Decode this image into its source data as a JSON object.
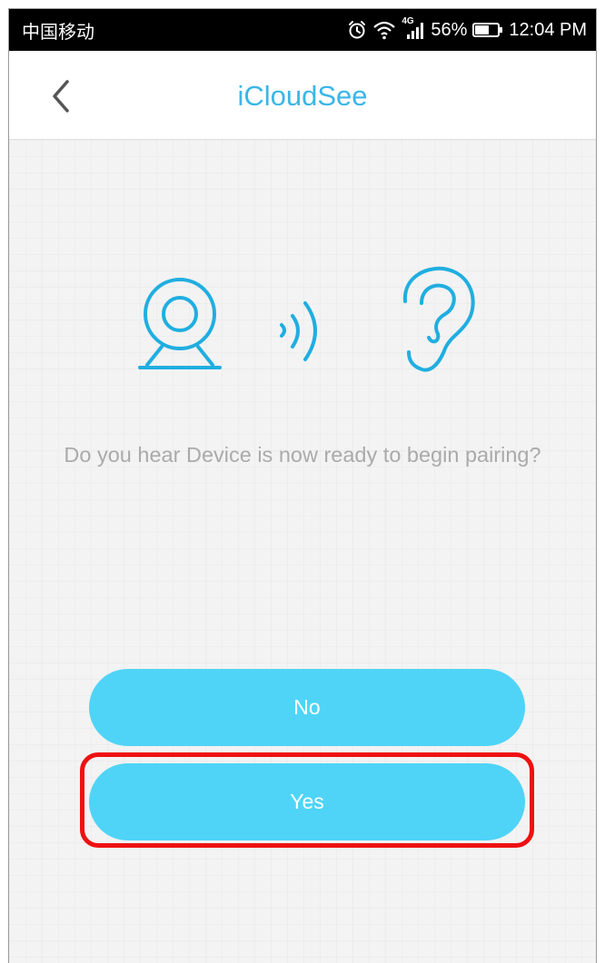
{
  "status_bar": {
    "carrier": "中国移动",
    "network_type": "4G",
    "battery": "56%",
    "time": "12:04 PM"
  },
  "header": {
    "title": "iCloudSee"
  },
  "main": {
    "prompt": "Do you hear Device is now ready to begin pairing?"
  },
  "buttons": {
    "no_label": "No",
    "yes_label": "Yes"
  },
  "colors": {
    "accent": "#3bb6e6",
    "button": "#4fd4f7",
    "highlight": "#ee1111"
  }
}
